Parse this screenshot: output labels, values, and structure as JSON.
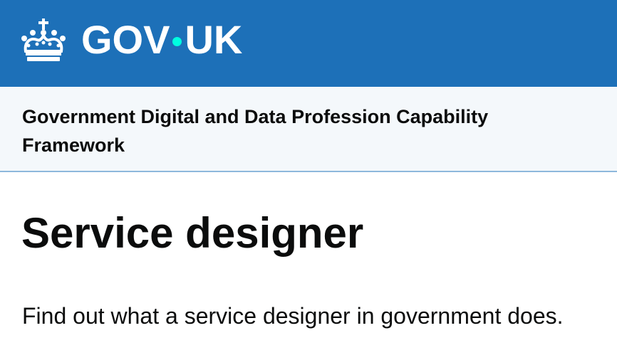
{
  "header": {
    "logo_text_left": "GOV",
    "logo_text_right": "UK",
    "crown_icon": "crown-icon",
    "background_color": "#1d70b8",
    "dot_color": "#00ffe0"
  },
  "service": {
    "name": "Government Digital and Data Profession Capability Framework",
    "background_color": "#f4f8fb"
  },
  "main": {
    "title": "Service designer",
    "lead": "Find out what a service designer in government does."
  }
}
